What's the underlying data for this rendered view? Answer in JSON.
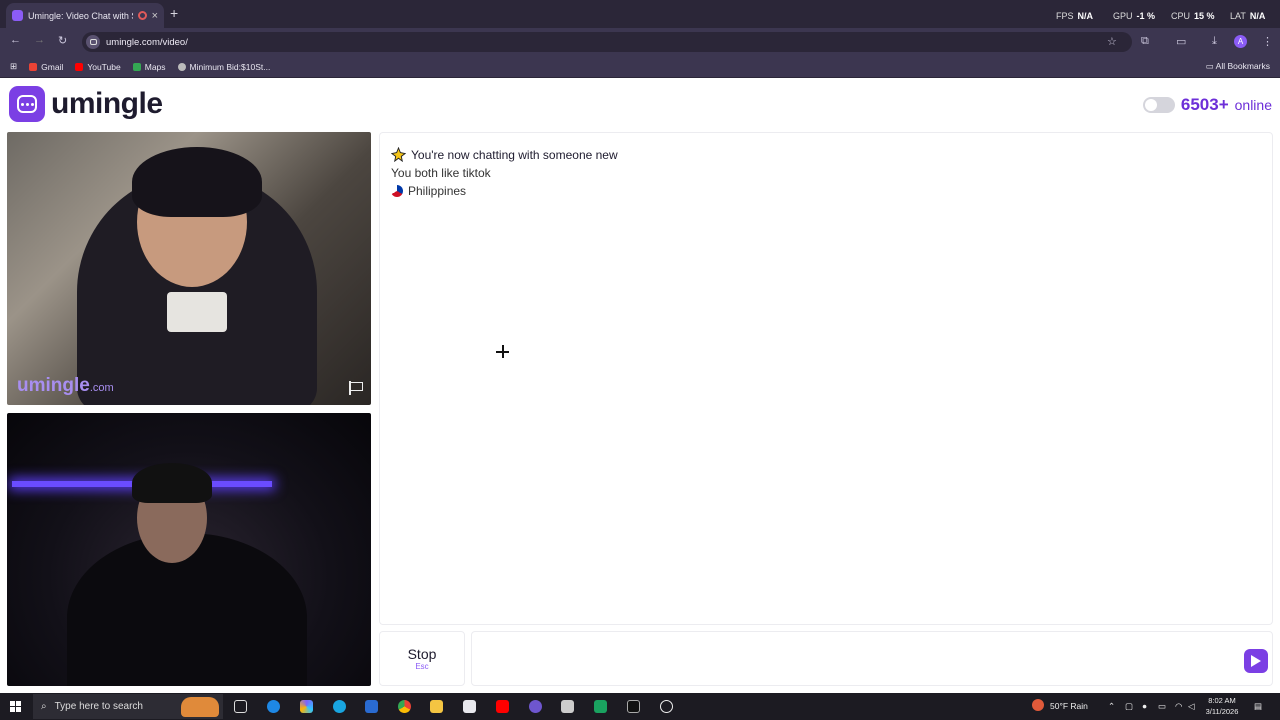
{
  "browser": {
    "tab_title": "Umingle: Video Chat with S",
    "url": "umingle.com/video/",
    "bookmarks": [
      "Gmail",
      "YouTube",
      "Maps",
      "Minimum Bid:$10St..."
    ],
    "all_bookmarks": "All Bookmarks"
  },
  "overlay": {
    "fps_label": "FPS",
    "fps_value": "N/A",
    "gpu_label": "GPU",
    "gpu_value": "-1 %",
    "cpu_label": "CPU",
    "cpu_value": "15 %",
    "lat_label": "LAT",
    "lat_value": "N/A"
  },
  "site": {
    "logo_text": "umingle",
    "online_count": "6503+",
    "online_label": "online",
    "watermark_main": "umingle",
    "watermark_suffix": ".com"
  },
  "chat": {
    "messages": [
      "You're now chatting with someone new",
      "You both like tiktok",
      "Philippines"
    ]
  },
  "controls": {
    "stop_label": "Stop",
    "stop_key": "Esc"
  },
  "taskbar": {
    "search_placeholder": "Type here to search",
    "weather": "50°F  Rain",
    "time": "8:02 AM",
    "date": "3/11/2026"
  },
  "colors": {
    "brand": "#7b3fe4",
    "online_text": "#6d2fd8"
  }
}
